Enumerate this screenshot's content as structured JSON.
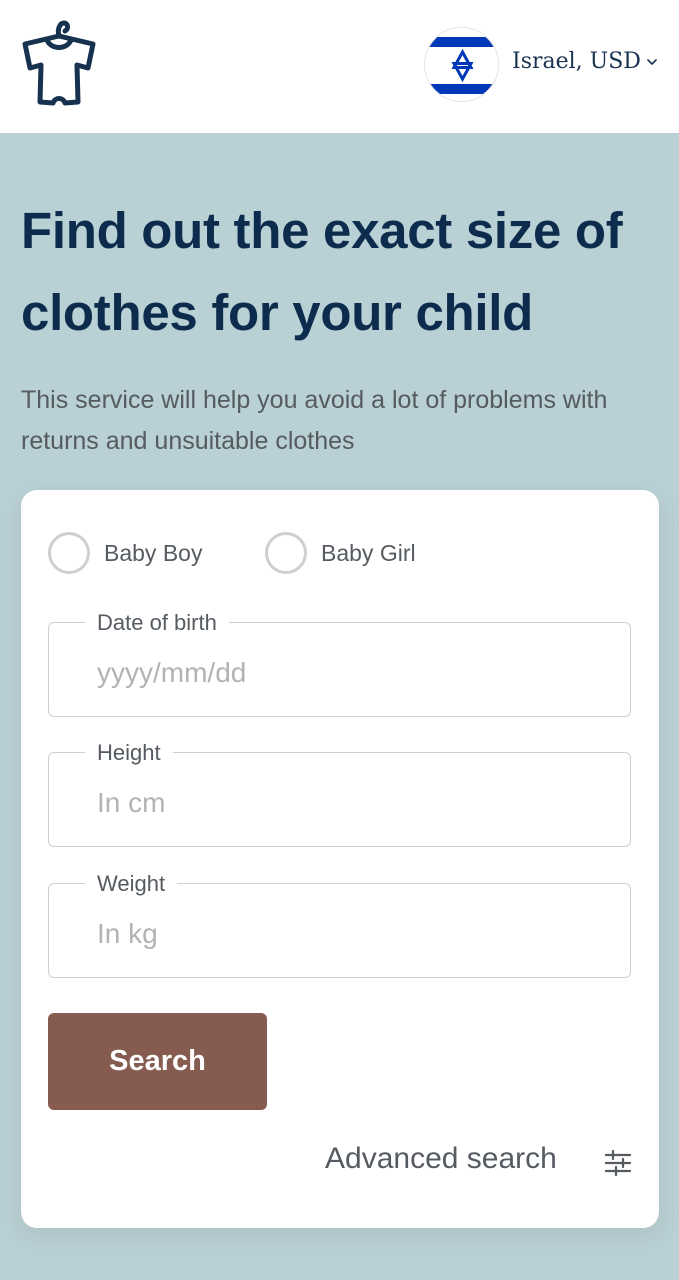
{
  "header": {
    "logo_icon": "baby-onesie-hanger-icon",
    "flag_icon": "israel-flag-icon",
    "locale_label": "Israel, USD",
    "chevron_icon": "chevron-down-icon"
  },
  "hero": {
    "title": "Find out the exact size of clothes for your child",
    "subtitle": "This service will help you avoid a lot of problems with returns and unsuitable clothes"
  },
  "form": {
    "gender_options": [
      {
        "label": "Baby Boy",
        "selected": false
      },
      {
        "label": "Baby Girl",
        "selected": false
      }
    ],
    "fields": {
      "dob": {
        "label": "Date of birth",
        "placeholder": "yyyy/mm/dd",
        "value": ""
      },
      "height": {
        "label": "Height",
        "placeholder": "In cm",
        "value": ""
      },
      "weight": {
        "label": "Weight",
        "placeholder": "In kg",
        "value": ""
      }
    },
    "search_label": "Search",
    "advanced_label": "Advanced search",
    "advanced_icon": "sliders-icon"
  },
  "colors": {
    "page_background": "#b9d0d4",
    "heading": "#0d2c4d",
    "body_text": "#555b61",
    "button": "#855c4f",
    "flag_blue": "#0038b8"
  }
}
